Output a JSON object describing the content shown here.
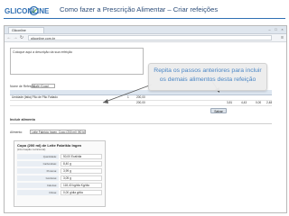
{
  "brand": {
    "logo_text": "GLICONLINE",
    "accent": "#2f6fb3"
  },
  "slide": {
    "title": "Como fazer a Prescrição Alimentar – Criar refeições"
  },
  "browser": {
    "tab_label": "Gliconline",
    "url": "gliconline.com.br",
    "window_buttons": [
      "–",
      "□",
      "×"
    ],
    "nav_icons": [
      "back-icon",
      "forward-icon",
      "refresh-icon"
    ]
  },
  "app": {
    "textarea_text": "Coloque aqui a descrição da sua refeição",
    "unit_label": "Nome de Refeição",
    "unit_value": "Café (Copo)",
    "table": {
      "rows": [
        [
          "Umidade (fatia) Pão de Pão Fatiado",
          "1",
          "200,00",
          "",
          "",
          "",
          ""
        ],
        [
          "",
          "",
          "200,00",
          "",
          "3,81",
          "4,43",
          "0,00",
          "2,48"
        ]
      ]
    },
    "save_button": "Salvar",
    "section_title": "Incluir alimento",
    "search_label": "Alimento:",
    "search_value": "Leite Fabricio Ingen. Copo (200 ml) (90 b)",
    "food": {
      "title": "Copo (200 ml) de Leite Fabriklo Ingen",
      "subtitle": "(informação nutricional)",
      "labels": [
        "Quantidade:",
        "Carboidrato:",
        "Proteína:",
        "Gorduras:",
        "Calorias:",
        "Fibras:"
      ],
      "values": [
        "50,00 Ecal/dia",
        "8,40 g",
        "3,99 g",
        "3,05 g",
        "118,40 kg/dia Kg/dia",
        "0,00 g/dia g/dia"
      ]
    }
  },
  "callout": {
    "line1": "Repita os passos anteriores para incluir",
    "line2": "os demais alimentos desta refeição",
    "text_color": "#4a86c5"
  }
}
